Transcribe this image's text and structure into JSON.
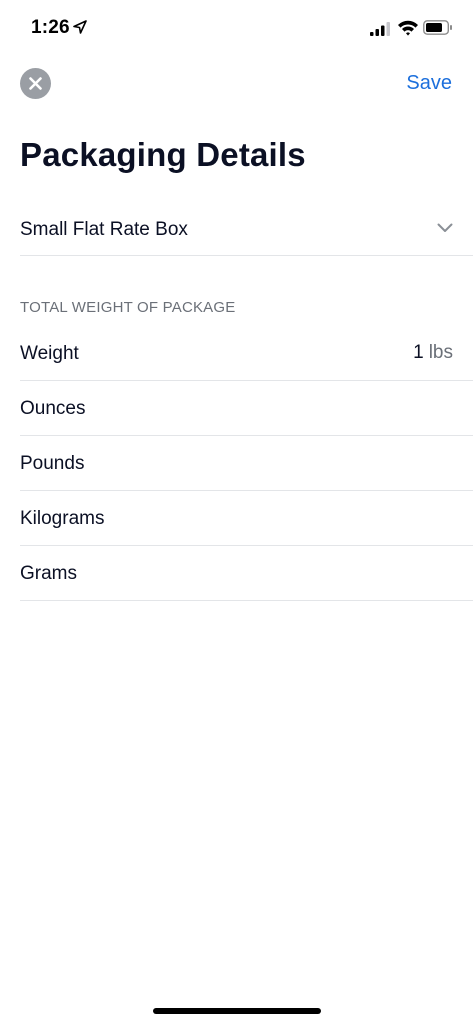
{
  "status_bar": {
    "time": "1:26"
  },
  "nav": {
    "save_label": "Save"
  },
  "title": "Packaging Details",
  "package_select": {
    "value": "Small Flat Rate Box"
  },
  "weight_section": {
    "header": "TOTAL WEIGHT OF PACKAGE",
    "rows": [
      {
        "label": "Weight",
        "value": "1",
        "unit": "lbs"
      },
      {
        "label": "Ounces"
      },
      {
        "label": "Pounds"
      },
      {
        "label": "Kilograms"
      },
      {
        "label": "Grams"
      }
    ]
  },
  "icons": {
    "close": "close-icon",
    "chevron": "chevron-down-icon",
    "location": "location-arrow-icon",
    "signal": "cellular-signal-icon",
    "wifi": "wifi-icon",
    "battery": "battery-icon"
  },
  "colors": {
    "accent": "#1c6fdc",
    "title": "#0b1024",
    "muted": "#6b7078",
    "close_button_bg": "#9a9ea4",
    "divider": "#e3e5e8"
  }
}
